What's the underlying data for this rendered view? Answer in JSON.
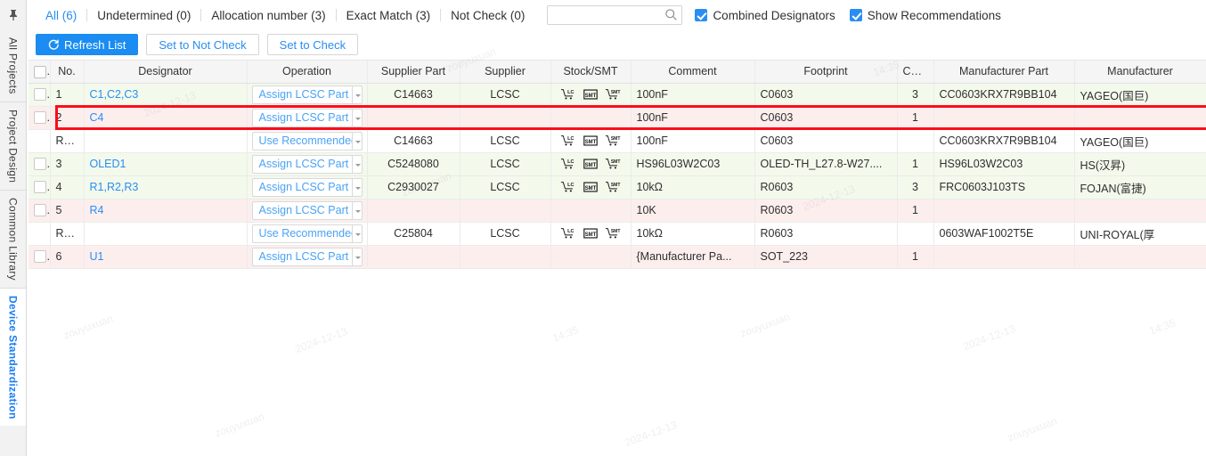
{
  "sidebar": {
    "pin_icon": "pin-icon",
    "items": [
      {
        "label": "All Projects",
        "active": false
      },
      {
        "label": "Project Design",
        "active": false
      },
      {
        "label": "Common Library",
        "active": false
      },
      {
        "label": "Device Standardization",
        "active": true
      }
    ]
  },
  "filterbar": {
    "tabs": [
      {
        "label": "All (6)",
        "active": true
      },
      {
        "label": "Undetermined (0)",
        "active": false
      },
      {
        "label": "Allocation number (3)",
        "active": false
      },
      {
        "label": "Exact Match (3)",
        "active": false
      },
      {
        "label": "Not Check (0)",
        "active": false
      }
    ],
    "search": {
      "value": "",
      "placeholder": "",
      "icon": "search-icon"
    },
    "checkboxes": [
      {
        "label": "Combined Designators",
        "checked": true
      },
      {
        "label": "Show Recommendations",
        "checked": true
      }
    ]
  },
  "toolbar": {
    "refresh_label": "Refresh List",
    "refresh_icon": "refresh-icon",
    "set_not_check_label": "Set to Not Check",
    "set_check_label": "Set to Check"
  },
  "table": {
    "columns": [
      "",
      "No.",
      "Designator",
      "Operation",
      "Supplier Part",
      "Supplier",
      "Stock/SMT",
      "Comment",
      "Footprint",
      "Count",
      "Manufacturer Part",
      "Manufacturer"
    ],
    "rows": [
      {
        "checkbox": true,
        "no": "1",
        "designator": "C1,C2,C3",
        "operation": "Assign LCSC Part",
        "supplier_part": "C14663",
        "supplier": "LCSC",
        "stock": true,
        "comment": "100nF",
        "footprint": "C0603",
        "count": "3",
        "manufacturer_part": "CC0603KRX7R9BB104",
        "manufacturer": "YAGEO(国巨)",
        "style": "green"
      },
      {
        "checkbox": true,
        "no": "2",
        "designator": "C4",
        "operation": "Assign LCSC Part",
        "supplier_part": "",
        "supplier": "",
        "stock": false,
        "comment": "100nF",
        "footprint": "C0603",
        "count": "1",
        "manufacturer_part": "",
        "manufacturer": "",
        "style": "pink",
        "highlighted": true
      },
      {
        "checkbox": false,
        "no": "Rec...",
        "designator": "",
        "operation": "Use Recommended D",
        "supplier_part": "C14663",
        "supplier": "LCSC",
        "stock": true,
        "comment": "100nF",
        "footprint": "C0603",
        "count": "",
        "manufacturer_part": "CC0603KRX7R9BB104",
        "manufacturer": "YAGEO(国巨)",
        "style": "white"
      },
      {
        "checkbox": true,
        "no": "3",
        "designator": "OLED1",
        "operation": "Assign LCSC Part",
        "supplier_part": "C5248080",
        "supplier": "LCSC",
        "stock": true,
        "comment": "HS96L03W2C03",
        "footprint": "OLED-TH_L27.8-W27....",
        "count": "1",
        "manufacturer_part": "HS96L03W2C03",
        "manufacturer": "HS(汉昇)",
        "style": "green"
      },
      {
        "checkbox": true,
        "no": "4",
        "designator": "R1,R2,R3",
        "operation": "Assign LCSC Part",
        "supplier_part": "C2930027",
        "supplier": "LCSC",
        "stock": true,
        "comment": "10kΩ",
        "footprint": "R0603",
        "count": "3",
        "manufacturer_part": "FRC0603J103TS",
        "manufacturer": "FOJAN(富捷)",
        "style": "green"
      },
      {
        "checkbox": true,
        "no": "5",
        "designator": "R4",
        "operation": "Assign LCSC Part",
        "supplier_part": "",
        "supplier": "",
        "stock": false,
        "comment": "10K",
        "footprint": "R0603",
        "count": "1",
        "manufacturer_part": "",
        "manufacturer": "",
        "style": "pink"
      },
      {
        "checkbox": false,
        "no": "Rec...",
        "designator": "",
        "operation": "Use Recommended D",
        "supplier_part": "C25804",
        "supplier": "LCSC",
        "stock": true,
        "comment": "10kΩ",
        "footprint": "R0603",
        "count": "",
        "manufacturer_part": "0603WAF1002T5E",
        "manufacturer": "UNI-ROYAL(厚",
        "style": "white"
      },
      {
        "checkbox": true,
        "no": "6",
        "designator": "U1",
        "operation": "Assign LCSC Part",
        "supplier_part": "",
        "supplier": "",
        "stock": false,
        "comment": "{Manufacturer Pa...",
        "footprint": "SOT_223",
        "count": "1",
        "manufacturer_part": "",
        "manufacturer": "",
        "style": "pink"
      }
    ],
    "stock_icons": [
      "cart-lc-icon",
      "smt-box-icon",
      "cart-smt-icon"
    ]
  },
  "colors": {
    "accent": "#2a8df2",
    "primary_button": "#1a8cf2",
    "highlight_box": "#fc0d1b",
    "row_green": "#f3faec",
    "row_pink": "#fdeeee"
  },
  "watermarks": [
    "zouyuxuan",
    "2024-12-13",
    "14:35"
  ]
}
